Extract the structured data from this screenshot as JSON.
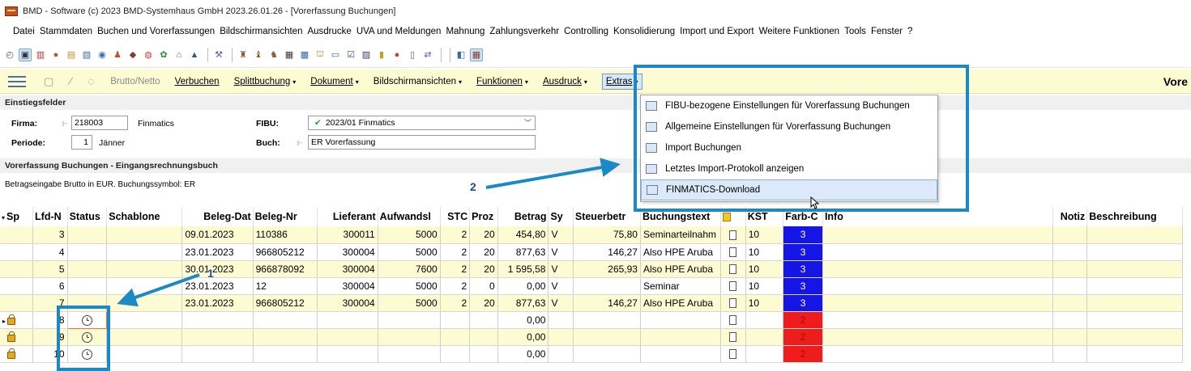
{
  "window": {
    "title": "BMD - Software   (c) 2023 BMD-Systemhaus GmbH 2023.26.01.26 - [Vorerfassung Buchungen]"
  },
  "menu": [
    "Datei",
    "Stammdaten",
    "Buchen und Vorerfassungen",
    "Bildschirmansichten",
    "Ausdrucke",
    "UVA und Meldungen",
    "Mahnung",
    "Zahlungsverkehr",
    "Controlling",
    "Konsolidierung",
    "Import und Export",
    "Weitere Funktionen",
    "Tools",
    "Fenster",
    "?"
  ],
  "ribbon": {
    "brutto_netto": "Brutto/Netto",
    "verbuchen": "Verbuchen",
    "splittbuchung": "Splittbuchung",
    "dokument": "Dokument",
    "bildschirmansichten": "Bildschirmansichten",
    "funktionen": "Funktionen",
    "ausdruck": "Ausdruck",
    "extras": "Extras",
    "right_title": "Vore"
  },
  "einstieg": {
    "header": "Einstiegsfelder",
    "firma_label": "Firma:",
    "firma_value": "218003",
    "firma_name": "Finmatics",
    "periode_label": "Periode:",
    "periode_value": "1",
    "periode_name": "Jänner",
    "fibu_label": "FIBU:",
    "fibu_value": "2023/01 Finmatics",
    "buch_label": "Buch:",
    "buch_value": "ER Vorerfassung"
  },
  "vorerfassung": {
    "header": "Vorerfassung Buchungen - Eingangsrechnungsbuch",
    "info": "Betragseingabe Brutto in EUR. Buchungssymbol: ER"
  },
  "extras_menu": [
    {
      "label": "FIBU-bezogene Einstellungen für Vorerfassung Buchungen",
      "icon": "settings-window-icon"
    },
    {
      "label": "Allgemeine Einstellungen für Vorerfassung Buchungen",
      "icon": "settings-window-icon"
    },
    {
      "label": "Import Buchungen",
      "icon": "import-icon"
    },
    {
      "label": "Letztes Import-Protokoll anzeigen",
      "icon": "protocol-icon"
    },
    {
      "label": "FINMATICS-Download",
      "icon": "download-icon"
    }
  ],
  "grid": {
    "columns": [
      "Sp",
      "Lfd-N",
      "Status",
      "Schablone",
      "Beleg-Dat",
      "Beleg-Nr",
      "Lieferant",
      "Aufwandsl",
      "STC",
      "Proz",
      "Betrag",
      "Sy",
      "Steuerbetr",
      "Buchungstext",
      "",
      "KST",
      "Farb-C",
      "Info",
      "Notiz",
      "Beschreibung"
    ],
    "rows": [
      {
        "lfd": "3",
        "status": "",
        "beleg_dat": "09.01.2023",
        "beleg_nr": "110386",
        "lieferant": "300011",
        "aufwand": "5000",
        "stc": "2",
        "proz": "20",
        "betrag": "454,80",
        "sy": "V",
        "steuer": "75,80",
        "text": "Seminarteilnahm",
        "kst": "10",
        "farb": "3"
      },
      {
        "lfd": "4",
        "status": "",
        "beleg_dat": "23.01.2023",
        "beleg_nr": "966805212",
        "lieferant": "300004",
        "aufwand": "5000",
        "stc": "2",
        "proz": "20",
        "betrag": "877,63",
        "sy": "V",
        "steuer": "146,27",
        "text": "Also HPE Aruba",
        "kst": "10",
        "farb": "3"
      },
      {
        "lfd": "5",
        "status": "",
        "beleg_dat": "30.01.2023",
        "beleg_nr": "966878092",
        "lieferant": "300004",
        "aufwand": "7600",
        "stc": "2",
        "proz": "20",
        "betrag": "1 595,58",
        "sy": "V",
        "steuer": "265,93",
        "text": "Also HPE Aruba",
        "kst": "10",
        "farb": "3"
      },
      {
        "lfd": "6",
        "status": "",
        "beleg_dat": "23.01.2023",
        "beleg_nr": "12",
        "lieferant": "300004",
        "aufwand": "5000",
        "stc": "2",
        "proz": "0",
        "betrag": "0,00",
        "sy": "V",
        "steuer": "",
        "text": "Seminar",
        "kst": "10",
        "farb": "3"
      },
      {
        "lfd": "7",
        "status": "",
        "beleg_dat": "23.01.2023",
        "beleg_nr": "966805212",
        "lieferant": "300004",
        "aufwand": "5000",
        "stc": "2",
        "proz": "20",
        "betrag": "877,63",
        "sy": "V",
        "steuer": "146,27",
        "text": "Also HPE Aruba",
        "kst": "10",
        "farb": "3"
      },
      {
        "lfd": "8",
        "status": "clock",
        "beleg_dat": "",
        "beleg_nr": "",
        "lieferant": "",
        "aufwand": "",
        "stc": "",
        "proz": "",
        "betrag": "0,00",
        "sy": "",
        "steuer": "",
        "text": "",
        "kst": "",
        "farb": "2"
      },
      {
        "lfd": "9",
        "status": "clock",
        "beleg_dat": "",
        "beleg_nr": "",
        "lieferant": "",
        "aufwand": "",
        "stc": "",
        "proz": "",
        "betrag": "0,00",
        "sy": "",
        "steuer": "",
        "text": "",
        "kst": "",
        "farb": "2"
      },
      {
        "lfd": "10",
        "status": "clock",
        "beleg_dat": "",
        "beleg_nr": "",
        "lieferant": "",
        "aufwand": "",
        "stc": "",
        "proz": "",
        "betrag": "0,00",
        "sy": "",
        "steuer": "",
        "text": "",
        "kst": "",
        "farb": "2"
      }
    ]
  },
  "annotations": {
    "badge1": "1",
    "badge2": "2"
  },
  "colors": {
    "frame": "#1b8ac4",
    "farb_blue": "#1515e6",
    "farb_red": "#ee1c1c",
    "row_yellow": "#fdfbd2"
  }
}
